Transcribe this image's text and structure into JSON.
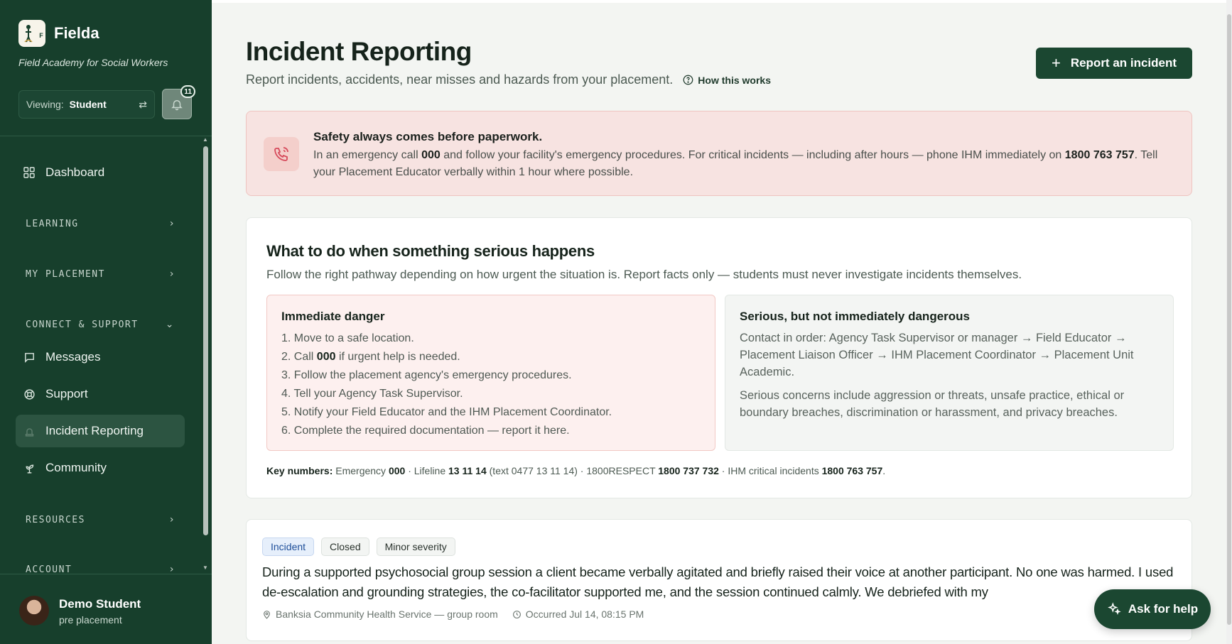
{
  "sidebar": {
    "brand_name": "Fielda",
    "brand_logo_letter": "F",
    "tagline": "Field Academy for Social Workers",
    "viewing_label": "Viewing:",
    "viewing_value": "Student",
    "notification_count": "11",
    "nav": {
      "dashboard": "Dashboard",
      "learning": "LEARNING",
      "my_placement": "MY PLACEMENT",
      "connect_support": "CONNECT & SUPPORT",
      "messages": "Messages",
      "support": "Support",
      "incident_reporting": "Incident Reporting",
      "community": "Community",
      "resources": "RESOURCES",
      "account": "ACCOUNT"
    },
    "user": {
      "name": "Demo Student",
      "role": "pre placement"
    }
  },
  "header": {
    "title": "Incident Reporting",
    "subtitle": "Report incidents, accidents, near misses and hazards from your placement.",
    "how_link": "How this works",
    "report_button": "Report an incident"
  },
  "alert": {
    "title": "Safety always comes before paperwork.",
    "text_1": "In an emergency call ",
    "emergency": "000",
    "text_2": " and follow your facility's emergency procedures. For critical incidents — including after hours — phone IHM immediately on ",
    "ihm_number": "1800 763 757",
    "text_3": ". Tell your Placement Educator verbally within 1 hour where possible."
  },
  "guide": {
    "title": "What to do when something serious happens",
    "subtitle": "Follow the right pathway depending on how urgent the situation is. Report facts only — students must never investigate incidents themselves.",
    "danger": {
      "title": "Immediate danger",
      "step1": "1. Move to a safe location.",
      "step2_a": "2. Call ",
      "step2_b": "000",
      "step2_c": " if urgent help is needed.",
      "step3": "3. Follow the placement agency's emergency procedures.",
      "step4": "4. Tell your Agency Task Supervisor.",
      "step5": "5. Notify your Field Educator and the IHM Placement Coordinator.",
      "step6": "6. Complete the required documentation — report it here."
    },
    "serious": {
      "title": "Serious, but not immediately dangerous",
      "contact": "Contact in order: Agency Task Supervisor or manager → Field Educator → Placement Liaison Officer → IHM Placement Coordinator → Placement Unit Academic.",
      "concerns": "Serious concerns include aggression or threats, unsafe practice, ethical or boundary breaches, discrimination or harassment, and privacy breaches."
    },
    "key_numbers": {
      "label": "Key numbers:",
      "emergency_label": " Emergency ",
      "emergency": "000",
      "lifeline_label": " · Lifeline ",
      "lifeline": "13 11 14",
      "lifeline_text": " (text 0477 13 11 14) · 1800RESPECT ",
      "respect": "1800 737 732",
      "ihm_label": " · IHM critical incidents ",
      "ihm": "1800 763 757",
      "end": "."
    }
  },
  "incident": {
    "tag_type": "Incident",
    "tag_status": "Closed",
    "tag_severity": "Minor severity",
    "description": "During a supported psychosocial group session a client became verbally agitated and briefly raised their voice at another participant. No one was harmed. I used de-escalation and grounding strategies, the co-facilitator supported me, and the session continued calmly. We debriefed with my",
    "location": "Banksia Community Health Service — group room",
    "occurred": "Occurred Jul 14, 08:15 PM"
  },
  "help_button": "Ask for help",
  "colors": {
    "sidebar_bg": "#173f2c",
    "accent": "#1b4731",
    "alert_bg": "#f7e3e1",
    "danger_box_bg": "#fdf0ef",
    "tag_blue": "#1f4f9a"
  }
}
